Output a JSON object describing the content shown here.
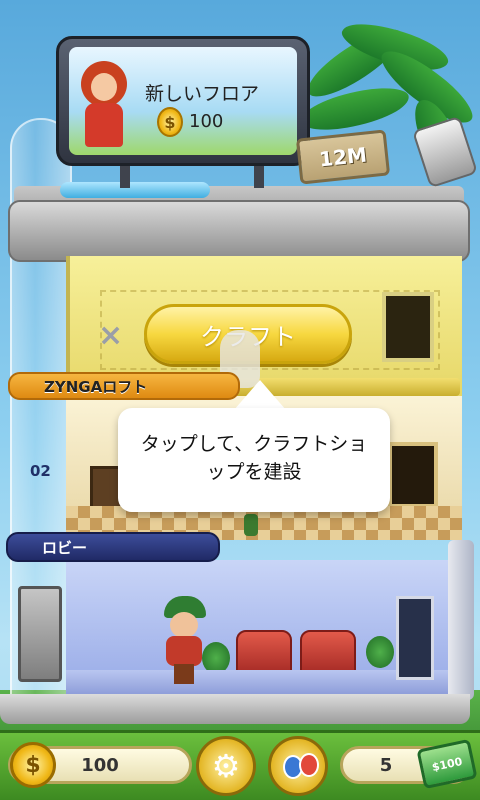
{
  "billboard": {
    "title": "新しいフロア",
    "coin_symbol": "$",
    "cost": "100"
  },
  "floor_level_sign": "12M",
  "craft_floor": {
    "button_label": "クラフト",
    "close_symbol": "×"
  },
  "tooltip": {
    "text": "タップして、クラフトショップを建設"
  },
  "loft_floor": {
    "label": "ZYNGAロフト",
    "floor_number": "02"
  },
  "lobby_floor": {
    "label": "ロビー"
  },
  "hud": {
    "coins": "100",
    "coin_symbol": "$",
    "bucks": "5",
    "bucks_note": "$100",
    "settings_icon": "gear-icon",
    "social_icon": "friends-icon"
  },
  "colors": {
    "craft_button": "#f7d840",
    "loft_banner": "#df8a12",
    "lobby_banner": "#202a66",
    "hud_bar": "#3d8a21"
  }
}
